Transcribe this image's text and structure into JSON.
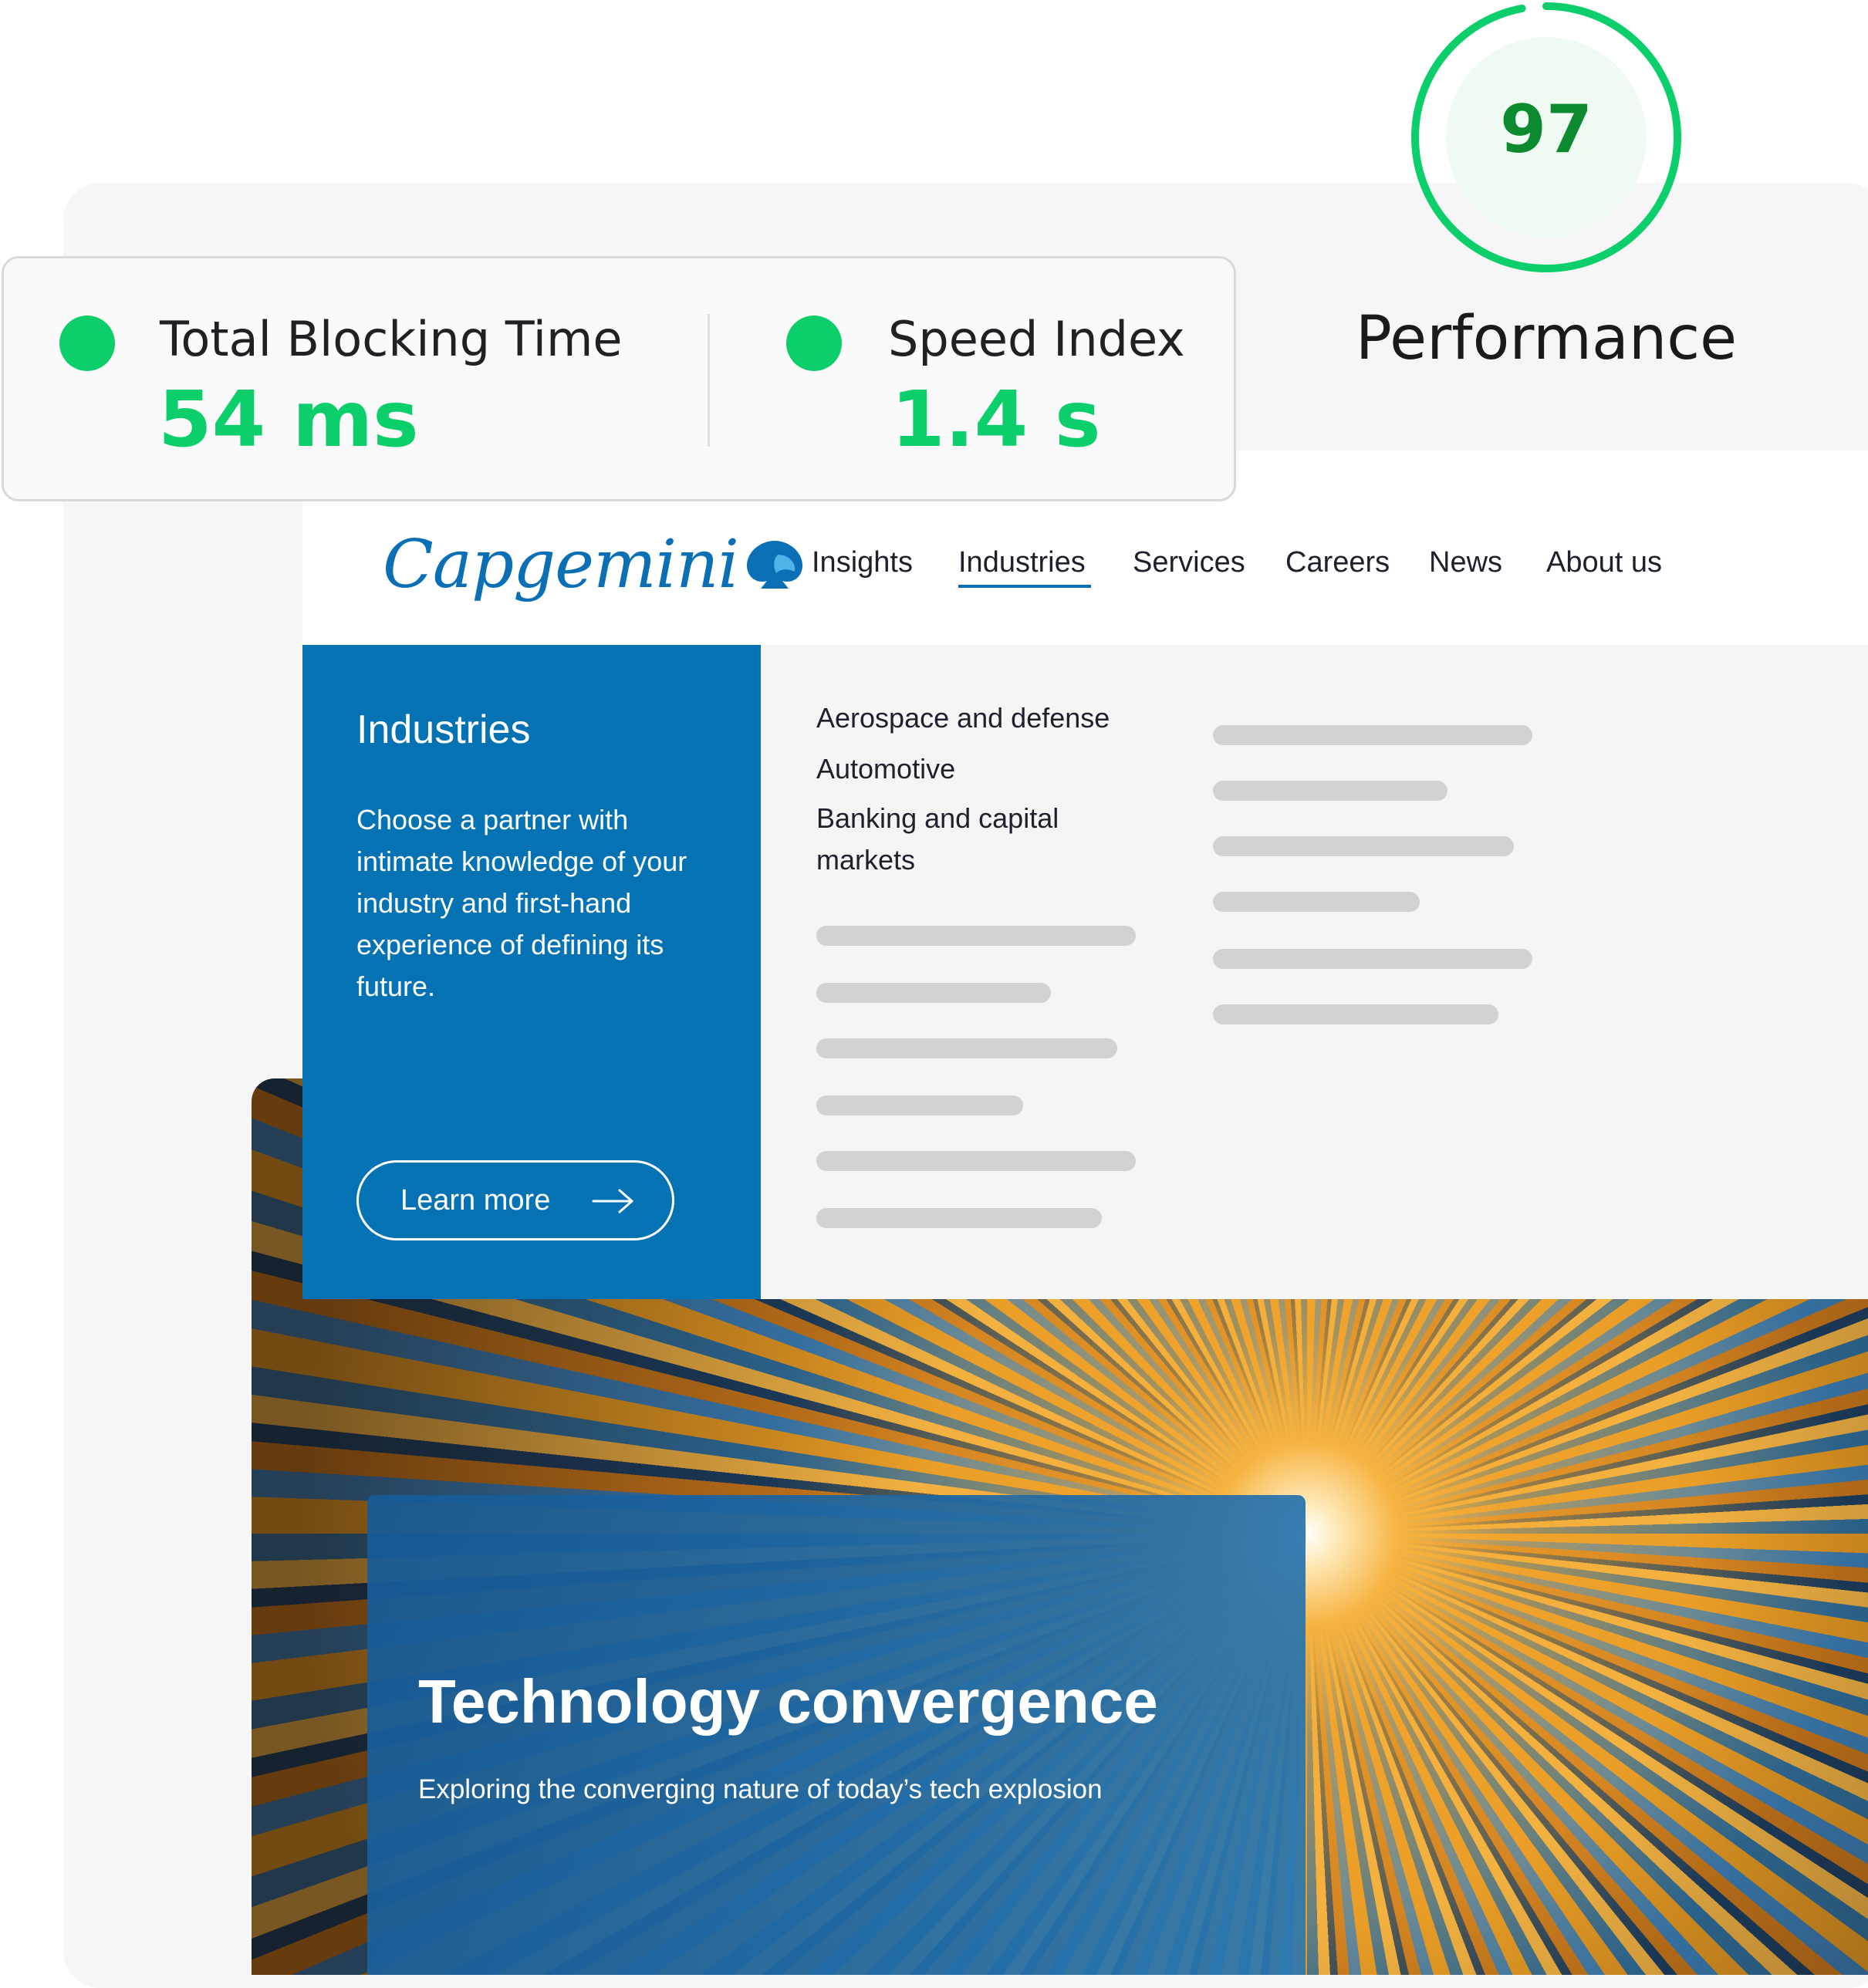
{
  "performance": {
    "score": "97",
    "label": "Performance",
    "score_fraction": 0.97,
    "color": "#0cce6b"
  },
  "metrics": [
    {
      "label": "Total Blocking Time",
      "value": "54 ms",
      "status": "good"
    },
    {
      "label": "Speed Index",
      "value": "1.4 s",
      "status": "good"
    }
  ],
  "site": {
    "logo": "Capgemini",
    "logo_icon": "spade-icon",
    "nav": [
      "Insights",
      "Industries",
      "Services",
      "Careers",
      "News",
      "About us"
    ],
    "active_nav": "Industries",
    "brand_color": "#0572b4",
    "menu": {
      "title": "Industries",
      "description": "Choose a partner with intimate knowledge of your industry and first-hand experience of defining its future.",
      "button": "Learn more",
      "links": [
        "Aerospace and defense",
        "Automotive",
        "Banking and capital markets"
      ]
    }
  },
  "hero": {
    "title": "Technology convergence",
    "subtitle": "Exploring the converging nature of today’s tech explosion"
  }
}
